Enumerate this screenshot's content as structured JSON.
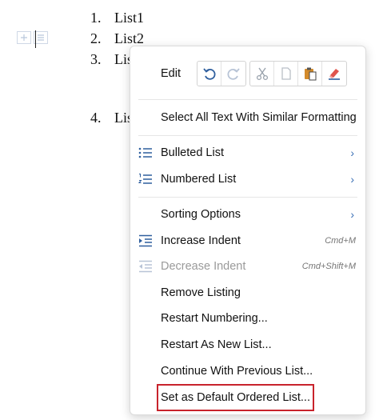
{
  "document": {
    "items": [
      {
        "num": "1.",
        "text": "List1"
      },
      {
        "num": "2.",
        "text": "List2"
      },
      {
        "num": "3.",
        "text": "Lis"
      },
      {
        "num": "4.",
        "text": "Lis"
      }
    ]
  },
  "menu": {
    "edit_label": "Edit",
    "items": {
      "select_all": "Select All Text With Similar Formatting",
      "bulleted": "Bulleted List",
      "numbered": "Numbered List",
      "sorting": "Sorting Options",
      "increase": "Increase Indent",
      "increase_shortcut": "Cmd+M",
      "decrease": "Decrease Indent",
      "decrease_shortcut": "Cmd+Shift+M",
      "remove": "Remove Listing",
      "restart_numbering": "Restart Numbering...",
      "restart_new": "Restart As New List...",
      "continue_prev": "Continue With Previous List...",
      "set_default": "Set as Default Ordered List..."
    },
    "chevron": "›"
  },
  "colors": {
    "accent": "#3a6fb5",
    "highlight": "#c8232c"
  },
  "icons": [
    "undo-icon",
    "redo-icon",
    "cut-icon",
    "copy-icon",
    "paste-icon",
    "clear-format-icon",
    "bullet-list-icon",
    "numbered-list-icon",
    "increase-indent-icon",
    "decrease-indent-icon"
  ]
}
